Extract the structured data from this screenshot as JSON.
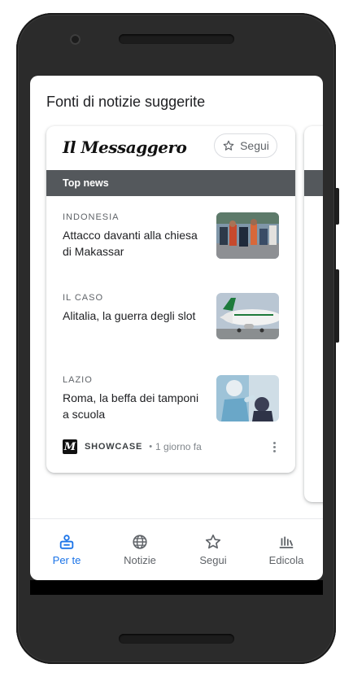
{
  "header": {
    "title": "Fonti di notizie suggerite"
  },
  "card": {
    "publisher": "Il Messaggero",
    "follow_label": "Segui",
    "section_label": "Top news",
    "articles": [
      {
        "kicker": "INDONESIA",
        "headline": "Attacco davanti alla chiesa di Makassar"
      },
      {
        "kicker": "IL CASO",
        "headline": "Alitalia, la guerra degli slot"
      },
      {
        "kicker": "LAZIO",
        "headline": "Roma, la beffa dei tamponi a scuola"
      }
    ],
    "footer": {
      "source": "SHOWCASE",
      "separator": "•",
      "time": "1 giorno fa"
    }
  },
  "nav": {
    "items": [
      {
        "label": "Per te",
        "icon": "for-you-icon",
        "active": true
      },
      {
        "label": "Notizie",
        "icon": "globe-icon",
        "active": false
      },
      {
        "label": "Segui",
        "icon": "star-icon",
        "active": false
      },
      {
        "label": "Edicola",
        "icon": "newsstand-icon",
        "active": false
      }
    ]
  },
  "colors": {
    "accent": "#1a73e8",
    "section_bar": "#54585c",
    "frame": "#2b2b2b"
  }
}
